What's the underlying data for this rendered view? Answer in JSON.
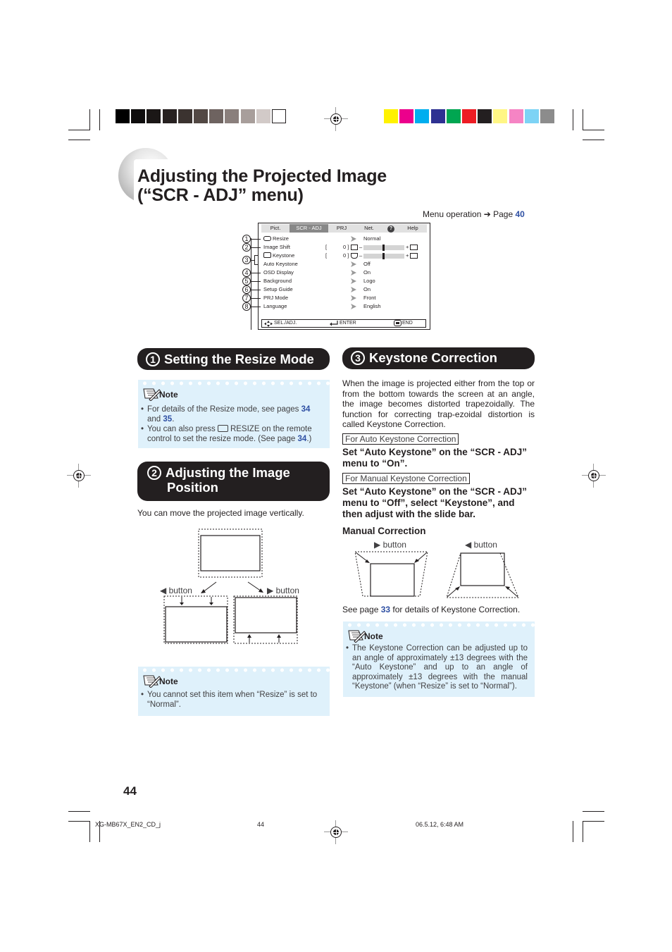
{
  "color_bar": {
    "grayscale": [
      "#000000",
      "#0f0d0d",
      "#1b1716",
      "#272120",
      "#3b3330",
      "#524844",
      "#6e6360",
      "#8a7f7c",
      "#a89e9b",
      "#d2cac8",
      "#ffffff"
    ],
    "color": [
      "#fff200",
      "#ec008c",
      "#00aeef",
      "#2e3192",
      "#00a651",
      "#ed1c24",
      "#231f20",
      "#fff685",
      "#f584c4",
      "#7dd3f5",
      "#8c8c8c"
    ]
  },
  "page": {
    "title_line1": "Adjusting the Projected Image",
    "title_line2": "(“SCR - ADJ” menu)",
    "menu_operation": "Menu operation ➔ Page ",
    "menu_operation_page": "40",
    "page_number": "44"
  },
  "osd_menu": {
    "tabs": [
      {
        "label": "Pict.",
        "active": false
      },
      {
        "label": "SCR - ADJ",
        "active": true
      },
      {
        "label": "PRJ",
        "active": false
      },
      {
        "label": "Net.",
        "active": false
      },
      {
        "label": "?",
        "active": false
      },
      {
        "label": "Help",
        "active": false
      }
    ],
    "rows": [
      {
        "callout": "1",
        "label": "Resize",
        "value": "Normal",
        "icon": "resize-icon"
      },
      {
        "callout": "2",
        "label": "Image Shift",
        "value": "0",
        "slider": true,
        "slider_level": 0.5
      },
      {
        "callout": "3",
        "label": "Keystone",
        "value": "0",
        "slider": true,
        "slider_level": 0.5,
        "icon": "keystone-icon"
      },
      {
        "callout": "",
        "label": "Auto Keystone",
        "value": "Off"
      },
      {
        "callout": "4",
        "label": "OSD Display",
        "value": "On"
      },
      {
        "callout": "5",
        "label": "Background",
        "value": "Logo"
      },
      {
        "callout": "6",
        "label": "Setup Guide",
        "value": "On"
      },
      {
        "callout": "7",
        "label": "PRJ Mode",
        "value": "Front"
      },
      {
        "callout": "8",
        "label": "Language",
        "value": "English"
      }
    ],
    "footer": {
      "sel_adj": "SEL./ADJ.",
      "enter": "ENTER",
      "end": "END"
    },
    "bracket": "[",
    "minus": "–",
    "plus": "+"
  },
  "section1": {
    "num": "1",
    "title": "Setting the Resize Mode",
    "note_label": "Note",
    "note_items": [
      {
        "pre": "For details of the Resize mode, see pages ",
        "link1": "34",
        "mid": " and ",
        "link2": "35",
        "post": "."
      },
      {
        "pre": "You can also press ",
        "icon": "resize-button-icon",
        "mid": "RESIZE on the remote control to set the resize mode. (See page ",
        "link1": "34",
        "post": ".)"
      }
    ]
  },
  "section2": {
    "num": "2",
    "title_line1": "Adjusting the Image",
    "title_line2": "Position",
    "intro": "You can move the projected image vertically.",
    "left_button": "◀ button",
    "right_button": "▶ button",
    "note_label": "Note",
    "note_items": [
      "You cannot set this item when “Resize” is set to “Normal”."
    ]
  },
  "section3": {
    "num": "3",
    "title": "Keystone Correction",
    "intro": "When the image is projected either from the top or from the bottom towards the screen at an angle, the image becomes distorted trapezoidally. The function for correcting trap-ezoidal distortion is called Keystone Correction.",
    "auto_label": "For Auto Keystone Correction",
    "auto_instr": "Set “Auto Keystone” on the “SCR - ADJ” menu to “On”.",
    "manual_label": "For Manual Keystone Correction",
    "manual_instr": "Set “Auto Keystone” on the “SCR - ADJ” menu to “Off”, select “Keystone”, and then adjust with the slide bar.",
    "manual_heading": "Manual Correction",
    "right_button": "▶ button",
    "left_button": "◀ button",
    "see_page_pre": "See page ",
    "see_page_link": "33",
    "see_page_post": " for details of Keystone Correction.",
    "note_label": "Note",
    "note_items": [
      "The Keystone Correction can be adjusted up to an angle of approximately ±13 degrees with the “Auto Keystone” and up to an angle of approximately ±13 degrees with the manual “Keystone” (when “Resize” is set to “Normal”)."
    ]
  },
  "footer": {
    "file": "XG-MB67X_EN2_CD_j",
    "page": "44",
    "timestamp": "06.5.12, 6:48 AM"
  }
}
